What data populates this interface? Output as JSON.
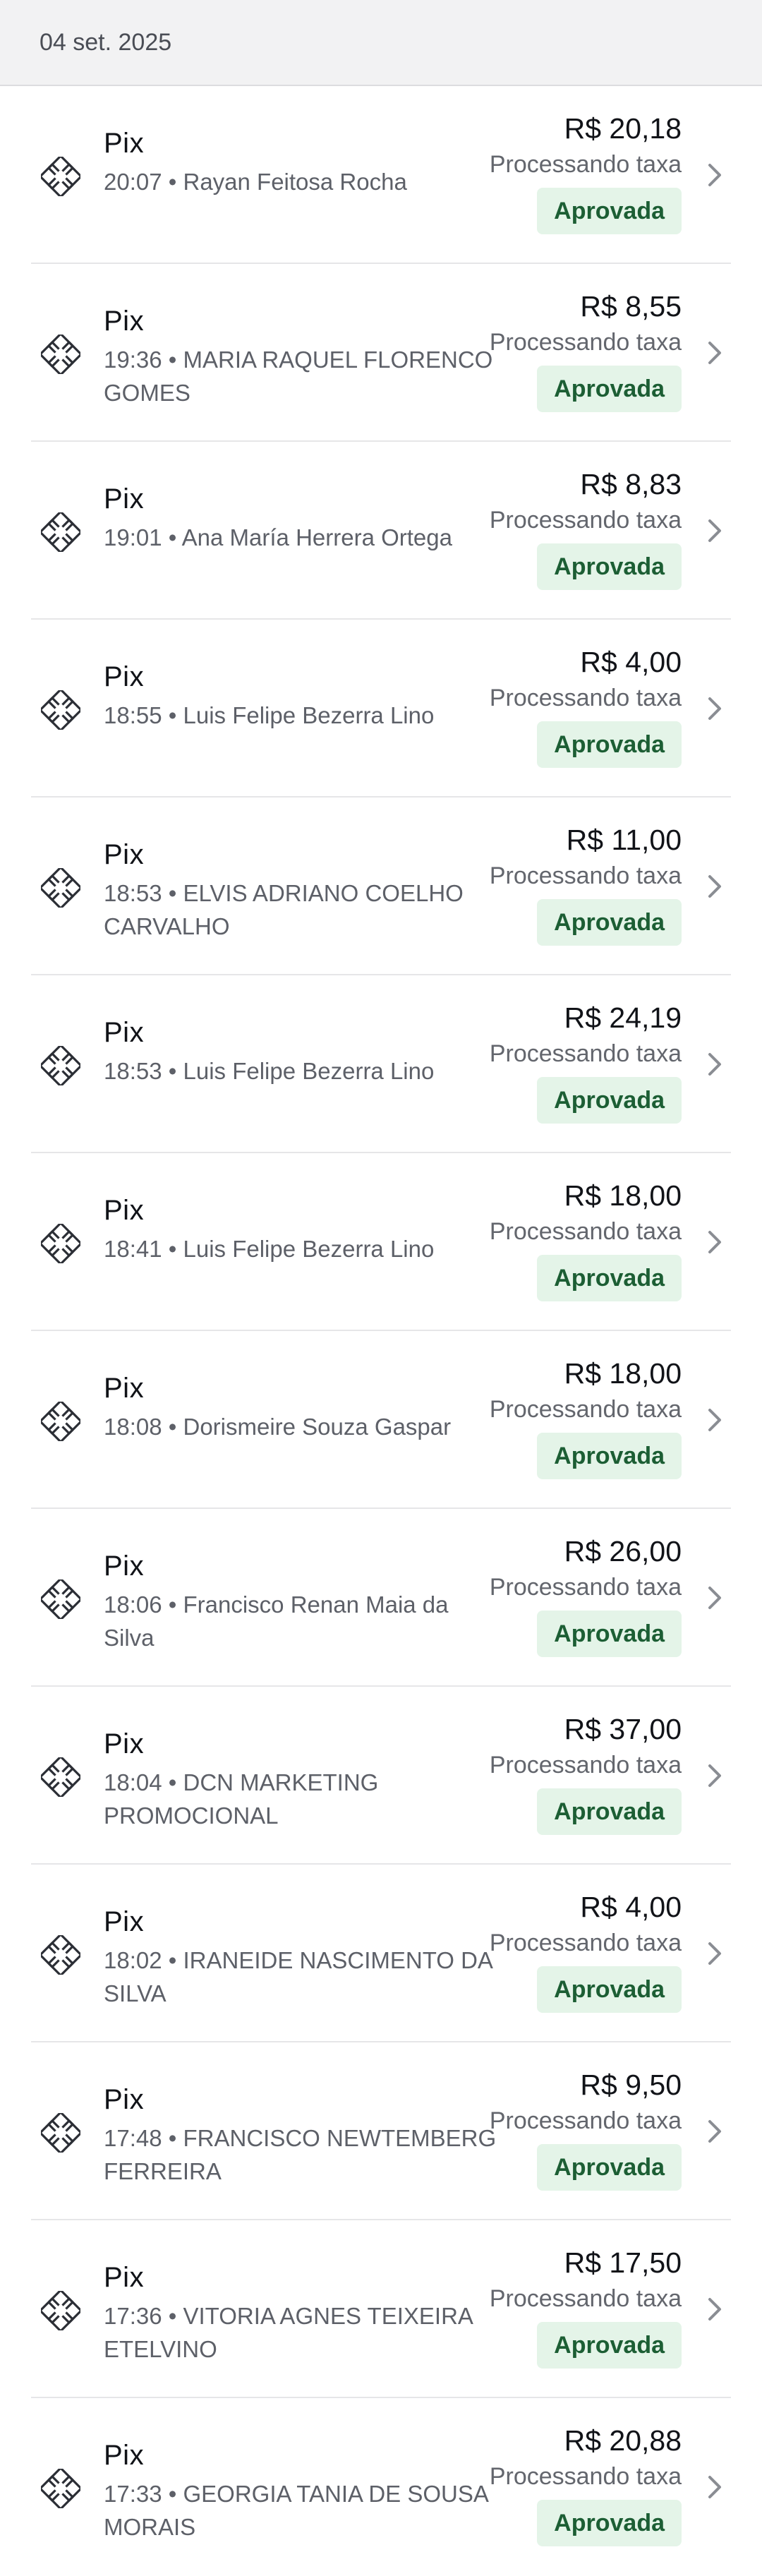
{
  "header": {
    "date": "04 set. 2025"
  },
  "transactions": [
    {
      "method": "Pix",
      "time": "20:07",
      "name": "Rayan Feitosa Rocha",
      "amount": "R$ 20,18",
      "fee_status": "Processando taxa",
      "status": "Aprovada"
    },
    {
      "method": "Pix",
      "time": "19:36",
      "name": "MARIA RAQUEL FLORENCO GOMES",
      "amount": "R$ 8,55",
      "fee_status": "Processando taxa",
      "status": "Aprovada"
    },
    {
      "method": "Pix",
      "time": "19:01",
      "name": "Ana María Herrera Ortega",
      "amount": "R$ 8,83",
      "fee_status": "Processando taxa",
      "status": "Aprovada"
    },
    {
      "method": "Pix",
      "time": "18:55",
      "name": "Luis Felipe Bezerra Lino",
      "amount": "R$ 4,00",
      "fee_status": "Processando taxa",
      "status": "Aprovada"
    },
    {
      "method": "Pix",
      "time": "18:53",
      "name": "ELVIS ADRIANO COELHO CARVALHO",
      "amount": "R$ 11,00",
      "fee_status": "Processando taxa",
      "status": "Aprovada"
    },
    {
      "method": "Pix",
      "time": "18:53",
      "name": "Luis Felipe Bezerra Lino",
      "amount": "R$ 24,19",
      "fee_status": "Processando taxa",
      "status": "Aprovada"
    },
    {
      "method": "Pix",
      "time": "18:41",
      "name": "Luis Felipe Bezerra Lino",
      "amount": "R$ 18,00",
      "fee_status": "Processando taxa",
      "status": "Aprovada"
    },
    {
      "method": "Pix",
      "time": "18:08",
      "name": "Dorismeire Souza Gaspar",
      "amount": "R$ 18,00",
      "fee_status": "Processando taxa",
      "status": "Aprovada"
    },
    {
      "method": "Pix",
      "time": "18:06",
      "name": "Francisco Renan Maia da Silva",
      "amount": "R$ 26,00",
      "fee_status": "Processando taxa",
      "status": "Aprovada"
    },
    {
      "method": "Pix",
      "time": "18:04",
      "name": "DCN MARKETING PROMOCIONAL",
      "amount": "R$ 37,00",
      "fee_status": "Processando taxa",
      "status": "Aprovada"
    },
    {
      "method": "Pix",
      "time": "18:02",
      "name": "IRANEIDE NASCIMENTO DA SILVA",
      "amount": "R$ 4,00",
      "fee_status": "Processando taxa",
      "status": "Aprovada"
    },
    {
      "method": "Pix",
      "time": "17:48",
      "name": "FRANCISCO NEWTEMBERG FERREIRA",
      "amount": "R$ 9,50",
      "fee_status": "Processando taxa",
      "status": "Aprovada"
    },
    {
      "method": "Pix",
      "time": "17:36",
      "name": "VITORIA AGNES TEIXEIRA ETELVINO",
      "amount": "R$ 17,50",
      "fee_status": "Processando taxa",
      "status": "Aprovada"
    },
    {
      "method": "Pix",
      "time": "17:33",
      "name": "GEORGIA TANIA DE SOUSA MORAIS",
      "amount": "R$ 20,88",
      "fee_status": "Processando taxa",
      "status": "Aprovada"
    }
  ],
  "separator": " • ",
  "colors": {
    "badge_bg": "#e4f4e8",
    "badge_text": "#1c5e34",
    "header_bg": "#f2f2f3"
  },
  "icons": {
    "method": "pix-icon",
    "row_action": "chevron-right-icon"
  }
}
